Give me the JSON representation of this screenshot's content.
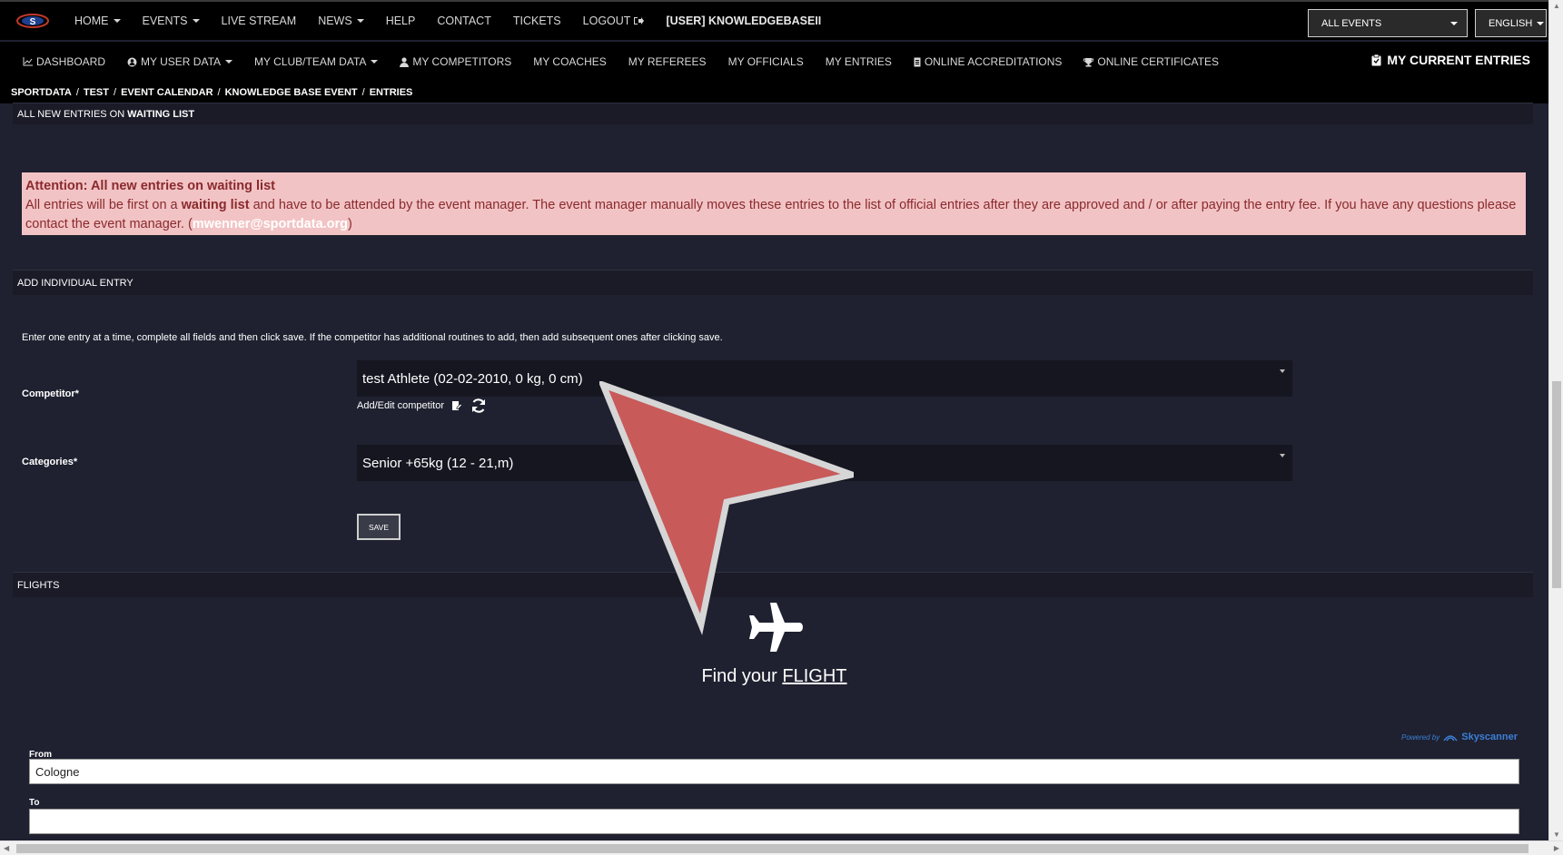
{
  "topnav": {
    "items": [
      {
        "label": "HOME",
        "caret": true
      },
      {
        "label": "EVENTS",
        "caret": true
      },
      {
        "label": "LIVE STREAM",
        "caret": false
      },
      {
        "label": "NEWS",
        "caret": true
      },
      {
        "label": "HELP",
        "caret": false
      },
      {
        "label": "CONTACT",
        "caret": false
      },
      {
        "label": "TICKETS",
        "caret": false
      },
      {
        "label": "LOGOUT",
        "caret": false
      }
    ],
    "user": "[USER] KNOWLEDGEBASEII",
    "events_select": "ALL EVENTS",
    "language_select": "ENGLISH"
  },
  "subnav": {
    "items": [
      "DASHBOARD",
      "MY USER DATA",
      "MY CLUB/TEAM DATA",
      "MY COMPETITORS",
      "MY COACHES",
      "MY REFEREES",
      "MY OFFICIALS",
      "MY ENTRIES",
      "ONLINE ACCREDITATIONS",
      "ONLINE CERTIFICATES"
    ],
    "current_entries": "MY CURRENT ENTRIES"
  },
  "breadcrumb": [
    "SPORTDATA",
    "TEST",
    "EVENT CALENDAR",
    "KNOWLEDGE BASE EVENT",
    "ENTRIES"
  ],
  "waiting_header": {
    "prefix": "ALL NEW ENTRIES ON ",
    "strong": "WAITING LIST"
  },
  "alert": {
    "title": "Attention: All new entries on waiting list",
    "text_1": "All entries will be first on a ",
    "text_bold": "waiting list",
    "text_2": " and have to be attended by the event manager. The event manager manually moves these entries to the list of official entries after they are approved and / or after paying the entry fee. If you have any questions please contact the event manager.  (",
    "email": "mwenner@sportdata.org",
    "text_3": ")"
  },
  "add_entry": {
    "header": "ADD INDIVIDUAL ENTRY",
    "intro": "Enter one entry at a time, complete all fields and then click save. If the competitor has additional routines to add, then add subsequent ones after clicking save.",
    "competitor_label": "Competitor*",
    "competitor_value": "test Athlete (02-02-2010, 0 kg, 0 cm)",
    "add_edit": "Add/Edit competitor",
    "categories_label": "Categories*",
    "categories_value": "Senior +65kg (12 - 21,m)",
    "save": "SAVE"
  },
  "flights": {
    "header": "FLIGHTS",
    "find_prefix": "Find your ",
    "find_link": "FLIGHT",
    "powered_prefix": "Powered by",
    "powered_brand": "Skyscanner",
    "from_label": "From",
    "from_value": "Cologne",
    "to_label": "To",
    "to_value": ""
  }
}
